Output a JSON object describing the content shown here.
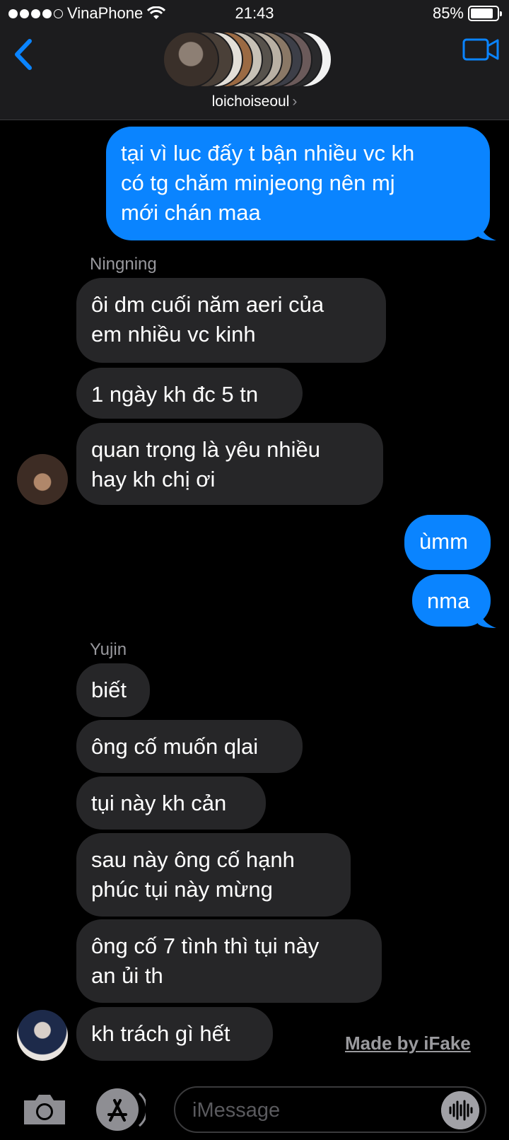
{
  "status": {
    "carrier": "VinaPhone",
    "time": "21:43",
    "battery": "85%",
    "battery_level": 0.85
  },
  "header": {
    "title": "loichoiseoul",
    "chevron": "›",
    "back_icon": "chevron-left-icon",
    "video_icon": "video-camera-icon"
  },
  "messages": [
    {
      "dir": "out",
      "text": "tại vì luc đấy t bận nhiều vc kh\ncó tg chăm minjeong nên mj\nmới chán maa"
    },
    {
      "dir": "in",
      "sender": "Ningning",
      "text": "ôi dm cuối năm aeri của\nem nhiều vc kinh"
    },
    {
      "dir": "in",
      "text": "1 ngày kh đc 5 tn"
    },
    {
      "dir": "in",
      "text": "quan trọng là yêu nhiều\nhay kh chị ơi"
    },
    {
      "dir": "out",
      "text": "ùmm"
    },
    {
      "dir": "out",
      "text": "nma"
    },
    {
      "dir": "in",
      "sender": "Yujin",
      "text": "biết"
    },
    {
      "dir": "in",
      "text": "ông cố muốn qlai"
    },
    {
      "dir": "in",
      "text": "tụi này kh cản"
    },
    {
      "dir": "in",
      "text": "sau này ông cố hạnh\nphúc tụi này mừng"
    },
    {
      "dir": "in",
      "text": "ông cố 7 tình thì tụi này\nan ủi th"
    },
    {
      "dir": "in",
      "text": "kh trách gì hết"
    }
  ],
  "watermark": "Made by iFake",
  "input": {
    "placeholder": "iMessage",
    "camera_icon": "camera-icon",
    "apps_icon": "app-store-icon",
    "audio_icon": "audio-waveform-icon"
  },
  "colors": {
    "accent": "#0a84ff",
    "incoming_bubble": "#262628",
    "header_bg": "#1c1c1e"
  }
}
